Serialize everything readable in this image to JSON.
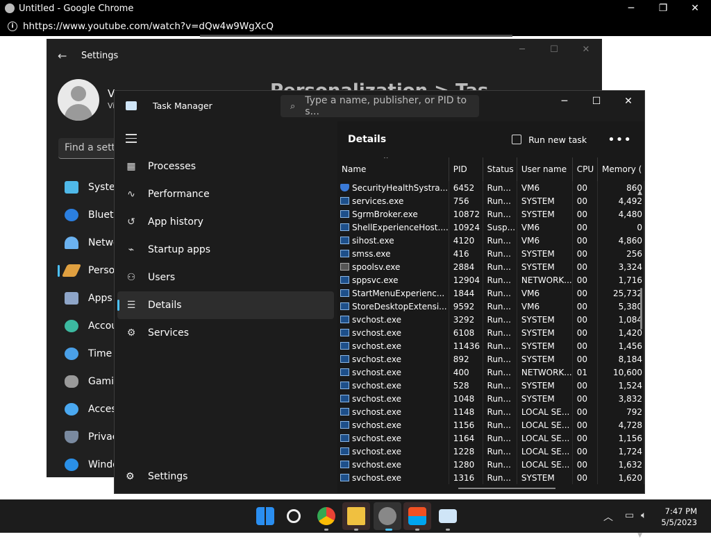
{
  "chrome": {
    "title": "Untitled - Google Chrome",
    "url": "hhttps://www.youtube.com/watch?v=dQw4w9WgXcQ",
    "minimize": "─",
    "maximize": "❐",
    "close": "✕"
  },
  "settings": {
    "title": "Settings",
    "account_initial": "V",
    "account_sub": "Vi",
    "breadcrumb": "Personalization  >  Tas",
    "search_placeholder": "Find a setti",
    "nav": [
      {
        "label": "Systen",
        "color": "#4fb8e8"
      },
      {
        "label": "Blueto",
        "color": "#2b7fe0"
      },
      {
        "label": "Netwo",
        "color": "#6bb2f0"
      },
      {
        "label": "Persor",
        "color": "#e0a040"
      },
      {
        "label": "Apps",
        "color": "#8ea5c8"
      },
      {
        "label": "Accou",
        "color": "#3cb9a0"
      },
      {
        "label": "Time &",
        "color": "#4aa0e8"
      },
      {
        "label": "Gamin",
        "color": "#9a9a9a"
      },
      {
        "label": "Acces",
        "color": "#4aa8f0"
      },
      {
        "label": "Privac",
        "color": "#7a8aa0"
      },
      {
        "label": "Windo",
        "color": "#2a90e8"
      }
    ]
  },
  "taskmanager": {
    "title": "Task Manager",
    "search_placeholder": "Type a name, publisher, or PID to s...",
    "nav": [
      {
        "label": "Processes",
        "icon": "▦"
      },
      {
        "label": "Performance",
        "icon": "∿"
      },
      {
        "label": "App history",
        "icon": "↺"
      },
      {
        "label": "Startup apps",
        "icon": "⌁"
      },
      {
        "label": "Users",
        "icon": "⚇"
      },
      {
        "label": "Details",
        "icon": "☰"
      },
      {
        "label": "Services",
        "icon": "⚙"
      }
    ],
    "settings_label": "Settings",
    "details_title": "Details",
    "run_new_task": "Run new task",
    "more": "•••",
    "columns": [
      "Name",
      "PID",
      "Status",
      "User name",
      "CPU",
      "Memory ("
    ],
    "rows": [
      [
        "SecurityHealthSystra...",
        "6452",
        "Run...",
        "VM6",
        "00",
        "860"
      ],
      [
        "services.exe",
        "756",
        "Run...",
        "SYSTEM",
        "00",
        "4,492"
      ],
      [
        "SgrmBroker.exe",
        "10872",
        "Run...",
        "SYSTEM",
        "00",
        "4,480"
      ],
      [
        "ShellExperienceHost....",
        "10924",
        "Susp...",
        "VM6",
        "00",
        "0"
      ],
      [
        "sihost.exe",
        "4120",
        "Run...",
        "VM6",
        "00",
        "4,860"
      ],
      [
        "smss.exe",
        "416",
        "Run...",
        "SYSTEM",
        "00",
        "256"
      ],
      [
        "spoolsv.exe",
        "2884",
        "Run...",
        "SYSTEM",
        "00",
        "3,324"
      ],
      [
        "sppsvc.exe",
        "12904",
        "Run...",
        "NETWORK...",
        "00",
        "1,716"
      ],
      [
        "StartMenuExperienc...",
        "1844",
        "Run...",
        "VM6",
        "00",
        "25,732"
      ],
      [
        "StoreDesktopExtensi...",
        "9592",
        "Run...",
        "VM6",
        "00",
        "5,380"
      ],
      [
        "svchost.exe",
        "3292",
        "Run...",
        "SYSTEM",
        "00",
        "1,084"
      ],
      [
        "svchost.exe",
        "6108",
        "Run...",
        "SYSTEM",
        "00",
        "1,420"
      ],
      [
        "svchost.exe",
        "11436",
        "Run...",
        "SYSTEM",
        "00",
        "1,456"
      ],
      [
        "svchost.exe",
        "892",
        "Run...",
        "SYSTEM",
        "00",
        "8,184"
      ],
      [
        "svchost.exe",
        "400",
        "Run...",
        "NETWORK...",
        "01",
        "10,600"
      ],
      [
        "svchost.exe",
        "528",
        "Run...",
        "SYSTEM",
        "00",
        "1,524"
      ],
      [
        "svchost.exe",
        "1048",
        "Run...",
        "SYSTEM",
        "00",
        "3,832"
      ],
      [
        "svchost.exe",
        "1148",
        "Run...",
        "LOCAL SE...",
        "00",
        "792"
      ],
      [
        "svchost.exe",
        "1156",
        "Run...",
        "LOCAL SE...",
        "00",
        "4,728"
      ],
      [
        "svchost.exe",
        "1164",
        "Run...",
        "LOCAL SE...",
        "00",
        "1,156"
      ],
      [
        "svchost.exe",
        "1228",
        "Run...",
        "LOCAL SE...",
        "00",
        "1,724"
      ],
      [
        "svchost.exe",
        "1280",
        "Run...",
        "LOCAL SE...",
        "00",
        "1,632"
      ],
      [
        "svchost.exe",
        "1316",
        "Run...",
        "SYSTEM",
        "00",
        "1,620"
      ]
    ]
  },
  "taskbar": {
    "time": "7:47 PM",
    "date": "5/5/2023"
  }
}
